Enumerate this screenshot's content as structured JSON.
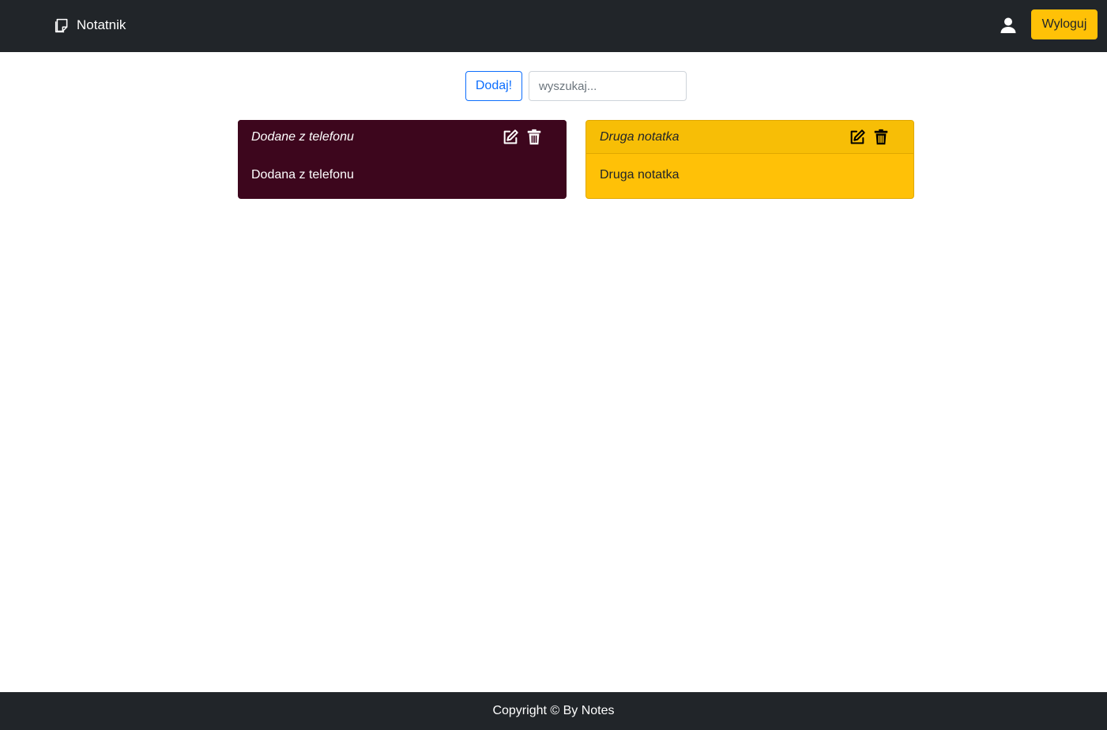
{
  "navbar": {
    "brand_label": "Notatnik",
    "brand_icon": "sticky-note-icon",
    "user_icon": "user-icon",
    "logout_label": "Wyloguj"
  },
  "toolbar": {
    "add_label": "Dodaj!",
    "search": {
      "placeholder": "wyszukaj...",
      "value": ""
    }
  },
  "notes": [
    {
      "title": "Dodane z telefonu",
      "body": "Dodana z telefonu",
      "color": "#3d061d"
    },
    {
      "title": "Druga notatka",
      "body": "Druga notatka",
      "color": "#ffc107"
    }
  ],
  "icons": {
    "edit": "edit-icon",
    "delete": "trash-icon"
  },
  "colors": {
    "navbar": "#212529",
    "accent": "#ffc107",
    "primary": "#0d6efd"
  },
  "footer": {
    "text": "Copyright © By Notes"
  }
}
